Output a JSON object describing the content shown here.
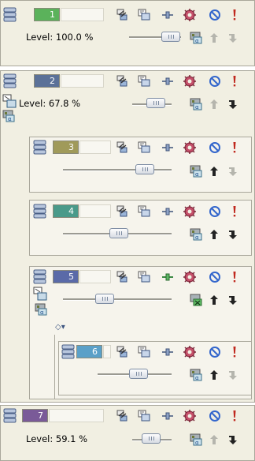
{
  "layers": [
    {
      "number": "1",
      "color": "#5bb25b",
      "level": "Level: 100.0 %",
      "slider": 1.0
    },
    {
      "number": "2",
      "color": "#5b7198",
      "level": "Level:  67.8 %",
      "slider": 0.68
    },
    {
      "number": "3",
      "color": "#a09a5a",
      "level": "",
      "slider": 0.72
    },
    {
      "number": "4",
      "color": "#4a9a8a",
      "level": "",
      "slider": 0.5
    },
    {
      "number": "5",
      "color": "#5a6aa8",
      "level": "",
      "slider": 0.33
    },
    {
      "number": "6",
      "color": "#5aa0c8",
      "level": "",
      "slider": 0.38
    },
    {
      "number": "7",
      "color": "#7a5a98",
      "level": "Level:  59.1 %",
      "slider": 0.38
    }
  ],
  "colors": {
    "panel": "#f1efe2",
    "border": "#a9a79b",
    "exclaim": "#c0281e",
    "forbid": "#3366cc",
    "gear": "#b83850"
  },
  "icons": [
    "layer-stack-icon",
    "link-icon",
    "mask-icon",
    "connector-icon",
    "gear-icon",
    "forbid-icon",
    "alert-icon",
    "alpha-icon",
    "arrow-up-icon",
    "arrow-down-icon"
  ]
}
